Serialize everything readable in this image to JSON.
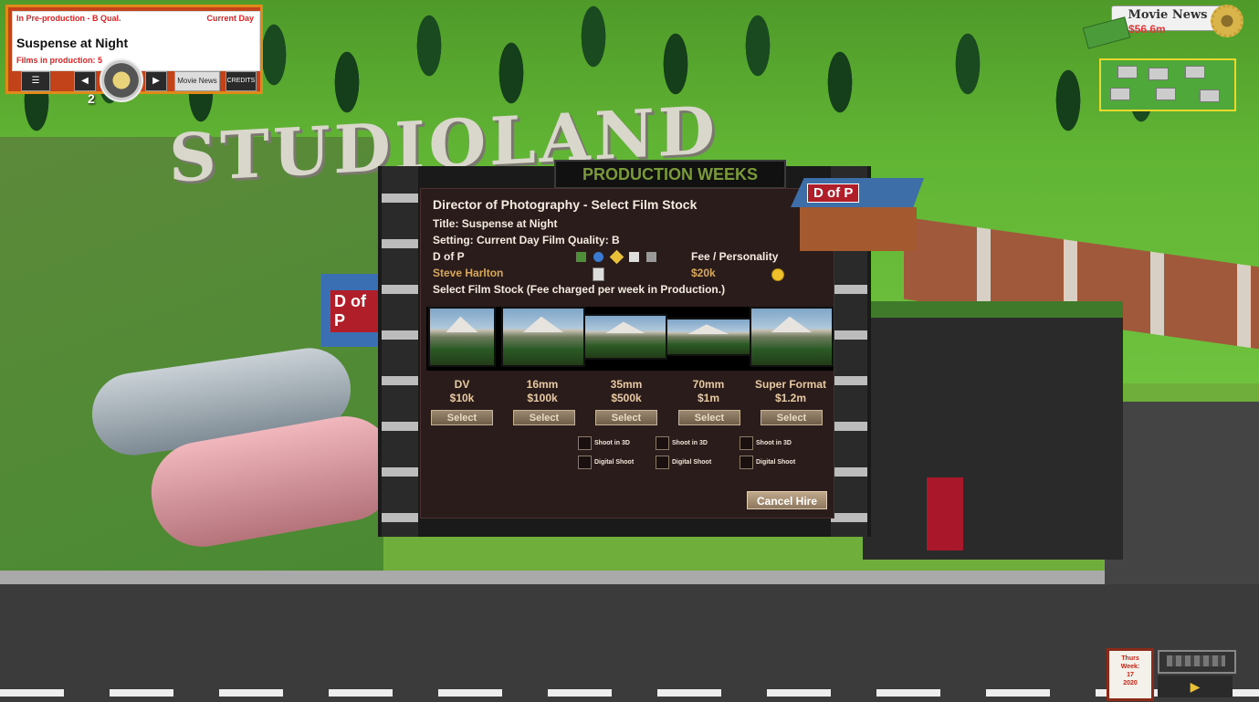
{
  "production_panel": {
    "status": "In Pre-production - B Qual.",
    "setting": "Current Day",
    "title": "Suspense at Night",
    "films_in_production": "Films in production: 5",
    "count_badge": "2",
    "movie_news_button": "Movie News",
    "credits_button": "CREDITS"
  },
  "top_right": {
    "movie_news_label": "Movie News",
    "money": "$56.6m"
  },
  "scene": {
    "studio_sign": "STUDIOLAND",
    "building_banner": "PRODUCTION  WEEKS",
    "dofp_label": "D of P"
  },
  "dialog": {
    "title": "Director of Photography - Select Film Stock",
    "film_title": "Title: Suspense at Night",
    "setting_quality": "Setting: Current Day  Film Quality: B",
    "dofp_header": "D of P",
    "fee_header": "Fee / Personality",
    "candidate_name": "Steve Harlton",
    "candidate_fee": "$20k",
    "candidate_badge": "1",
    "instruction": "Select Film Stock (Fee charged per week in Production.)",
    "stocks": [
      {
        "name": "DV",
        "price": "$10k",
        "button": "Select"
      },
      {
        "name": "16mm",
        "price": "$100k",
        "button": "Select"
      },
      {
        "name": "35mm",
        "price": "$500k",
        "button": "Select"
      },
      {
        "name": "70mm",
        "price": "$1m",
        "button": "Select"
      },
      {
        "name": "Super Format",
        "price": "$1.2m",
        "button": "Select"
      }
    ],
    "options": [
      {
        "shoot_3d": "Shoot in 3D",
        "digital": "Digital Shoot"
      },
      {
        "shoot_3d": "Shoot in 3D",
        "digital": "Digital Shoot"
      },
      {
        "shoot_3d": "Shoot in 3D",
        "digital": "Digital Shoot"
      }
    ],
    "cancel_button": "Cancel Hire"
  },
  "calendar": {
    "day": "Thurs",
    "week_label": "Week:",
    "week": "17",
    "year": "2020"
  },
  "icons": {
    "colors": {
      "accent_tan": "#d7a85b",
      "dialog_bg": "#2b1c1c",
      "money_red": "#e13838"
    }
  }
}
